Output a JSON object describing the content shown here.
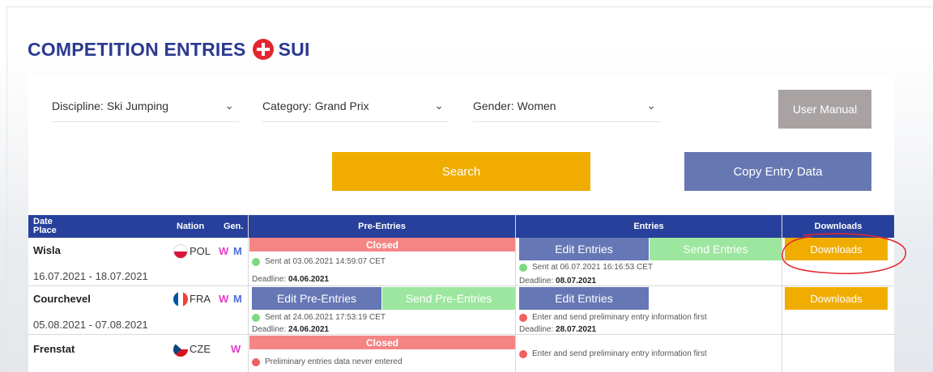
{
  "title": {
    "text": "COMPETITION ENTRIES",
    "nation_code": "SUI"
  },
  "filters": [
    {
      "label": "Discipline:",
      "value": "Ski Jumping"
    },
    {
      "label": "Category:",
      "value": "Grand Prix"
    },
    {
      "label": "Gender:",
      "value": "Women"
    }
  ],
  "buttons": {
    "user_manual": "User Manual",
    "search": "Search",
    "copy_entry_data": "Copy Entry Data"
  },
  "table": {
    "headers": {
      "date": "Date",
      "place": "Place",
      "nation": "Nation",
      "gender": "Gen.",
      "pre_entries": "Pre-Entries",
      "entries": "Entries",
      "downloads": "Downloads"
    },
    "rows": [
      {
        "place": "Wisla",
        "dates": "16.07.2021 - 18.07.2021",
        "nation": "POL",
        "g1": "W",
        "g2": "M",
        "pre_status": "Closed",
        "pre_sent": "Sent at 03.06.2021 14:59:07 CET",
        "pre_deadline_label": "Deadline:",
        "pre_deadline": "04.06.2021",
        "entries_edit": "Edit Entries",
        "entries_send": "Send Entries",
        "entries_sent": "Sent at 06.07.2021 16:16:53 CET",
        "entries_deadline_label": "Deadline:",
        "entries_deadline": "08.07.2021",
        "downloads": "Downloads"
      },
      {
        "place": "Courchevel",
        "dates": "05.08.2021 - 07.08.2021",
        "nation": "FRA",
        "g1": "W",
        "g2": "M",
        "pre_edit": "Edit Pre-Entries",
        "pre_send": "Send Pre-Entries",
        "pre_sent": "Sent at 24.06.2021 17:53:19 CET",
        "pre_deadline_label": "Deadline:",
        "pre_deadline": "24.06.2021",
        "entries_edit": "Edit Entries",
        "entries_msg": "Enter and send preliminary entry information first",
        "entries_deadline_label": "Deadline:",
        "entries_deadline": "28.07.2021",
        "downloads": "Downloads"
      },
      {
        "place": "Frenstat",
        "nation": "CZE",
        "g1": "W",
        "pre_status": "Closed",
        "pre_msg": "Preliminary entries data never entered",
        "entries_msg": "Enter and send preliminary entry information first"
      }
    ]
  },
  "colors": {
    "brand_blue": "#27409b",
    "orange": "#f0ad00",
    "edit_blue": "#6677b5",
    "send_green": "#9de69f",
    "closed_red": "#f48584"
  }
}
